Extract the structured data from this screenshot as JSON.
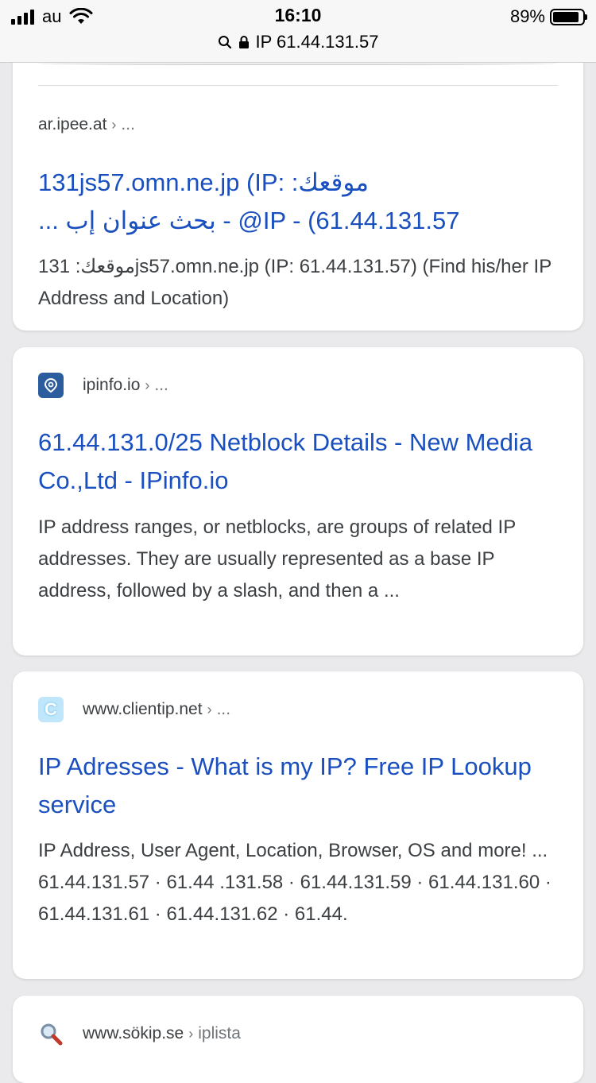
{
  "status_bar": {
    "carrier": "au",
    "time": "16:10",
    "battery": "89%",
    "battery_level": 0.89
  },
  "address_bar": {
    "url": "IP 61.44.131.57"
  },
  "results": [
    {
      "site": "ar.ipee.at",
      "breadcrumb": "...",
      "title_line1": "131js57.omn.ne.jp (IP: :موقعك",
      "title_line2": "... بحث عنوان إب - @IP - (61.44.131.57",
      "snippet": "131 :موقعكjs57.omn.ne.jp (IP: 61.44.131.57) (Find his/her IP Address and Location)"
    },
    {
      "site": "ipinfo.io",
      "breadcrumb": "...",
      "favicon": "ipinfo-pin-icon",
      "title": "61.44.131.0/25 Netblock Details - New Media Co.,Ltd - IPinfo.io",
      "snippet": "IP address ranges, or netblocks, are groups of related IP addresses. They are usually represented as a base IP address, followed by a slash, and then a ..."
    },
    {
      "site": "www.clientip.net",
      "breadcrumb": "...",
      "favicon": "clientip-c-icon",
      "favicon_letter": "C",
      "title": "IP Adresses - What is my IP? Free IP Lookup service",
      "snippet": "IP Address, User Agent, Location, Browser, OS and more! ... 61.44.131.57 · 61.44 .131.58 · 61.44.131.59 · 61.44.131.60 · 61.44.131.61 · 61.44.131.62 · 61.44."
    },
    {
      "site": "www.sökip.se",
      "breadcrumb": "iplista",
      "favicon": "magnifier-icon"
    }
  ],
  "colors": {
    "link": "#1a4fbf",
    "text": "#3c4043",
    "page_bg": "#eaeaec"
  }
}
